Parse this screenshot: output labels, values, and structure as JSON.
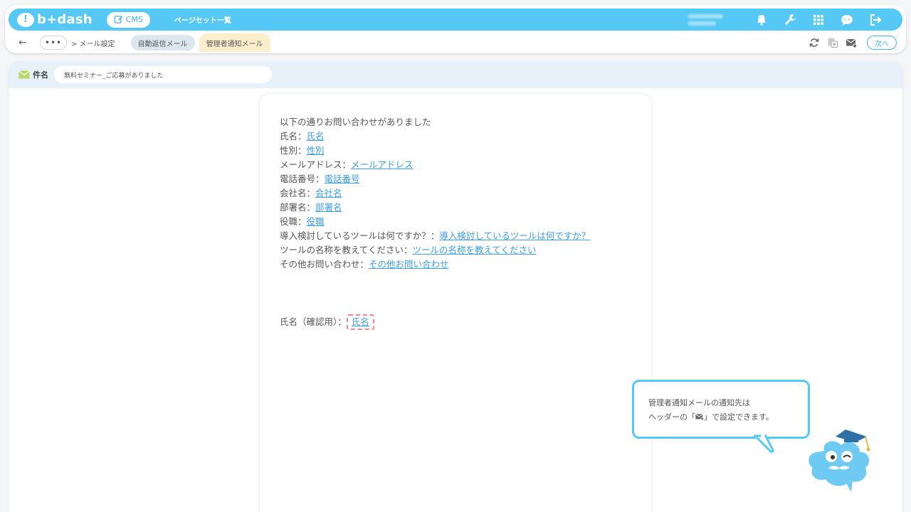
{
  "app": {
    "logo_text": "b+dash",
    "cms_label": "CMS",
    "nav_title": "ページセット一覧"
  },
  "topbar_icons": [
    "bell-icon",
    "wrench-icon",
    "grid-icon",
    "chat-icon",
    "logout-icon"
  ],
  "subbar": {
    "back_glyph": "←",
    "more_glyph": "•••",
    "breadcrumb": "> メール設定",
    "tabs": [
      {
        "label": "自動返信メール",
        "active": false
      },
      {
        "label": "管理者通知メール",
        "active": true
      }
    ],
    "next_label": "次へ"
  },
  "subject": {
    "label": "件名",
    "value": "無料セミナー_ご応募がありました"
  },
  "body": {
    "intro": "以下の通りお問い合わせがありました",
    "fields": [
      {
        "label": "氏名：",
        "tag": "氏名"
      },
      {
        "label": "性別：",
        "tag": "性別"
      },
      {
        "label": "メールアドレス：",
        "tag": "メールアドレス"
      },
      {
        "label": "電話番号：",
        "tag": "電話番号"
      },
      {
        "label": "会社名：",
        "tag": "会社名"
      },
      {
        "label": "部署名：",
        "tag": "部署名"
      },
      {
        "label": "役職：",
        "tag": "役職"
      },
      {
        "label": "導入検討しているツールは何ですか？：",
        "tag": "導入検討しているツールは何ですか？"
      },
      {
        "label": "ツールの名称を教えてください：",
        "tag": "ツールの名称を教えてください"
      },
      {
        "label": "その他お問い合わせ：",
        "tag": "その他お問い合わせ"
      }
    ],
    "confirm": {
      "label": "氏名（確認用）：",
      "tag": "氏名"
    }
  },
  "tooltip": {
    "line1": "管理者通知メールの通知先は",
    "line2_pre": "ヘッダーの「",
    "line2_post": "」で設定できます。"
  },
  "colors": {
    "brand": "#55c8f5",
    "link": "#3d9ee0",
    "highlight": "#f0868e",
    "tab_active": "#fbeecb"
  }
}
